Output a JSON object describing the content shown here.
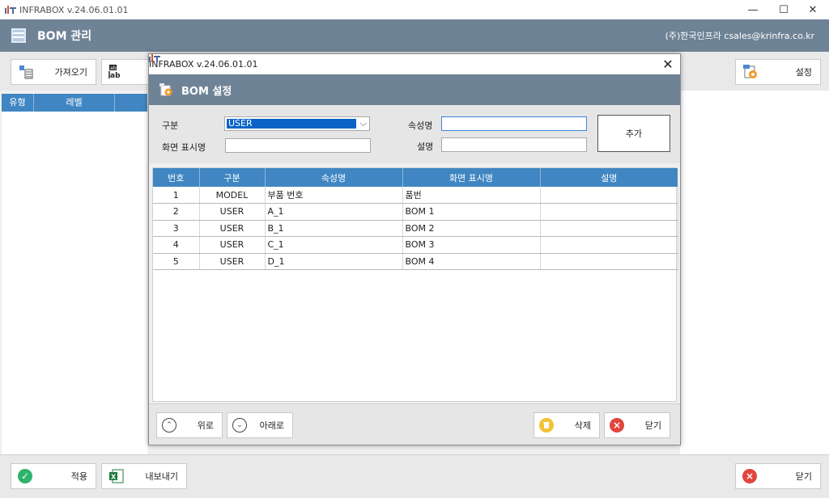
{
  "app": {
    "title": "INFRABOX  v.24.06.01.01",
    "header_title": "BOM 관리",
    "company": "(주)한국인프라  csales@krinfra.co.kr"
  },
  "window_controls": {
    "minimize": "—",
    "maximize": "☐",
    "close": "✕"
  },
  "toolbar": {
    "import_label": "가져오기",
    "settings_label": "설정"
  },
  "left_grid": {
    "columns": [
      "유형",
      "레벨"
    ]
  },
  "footer": {
    "apply_label": "적용",
    "export_label": "내보내기",
    "close_label": "닫기"
  },
  "dialog": {
    "title": "INFRABOX  v.24.06.01.01",
    "close": "✕",
    "header_title": "BOM 설정",
    "form": {
      "type_label": "구분",
      "type_value": "USER",
      "display_label": "화면 표시명",
      "display_value": "",
      "attr_label": "속성명",
      "attr_value": "",
      "desc_label": "설명",
      "desc_value": "",
      "add_label": "추가"
    },
    "table": {
      "columns": [
        "번호",
        "구분",
        "속성명",
        "화면 표시명",
        "설명"
      ],
      "rows": [
        [
          "1",
          "MODEL",
          "부품 번호",
          "품번",
          ""
        ],
        [
          "2",
          "USER",
          "A_1",
          "BOM 1",
          ""
        ],
        [
          "3",
          "USER",
          "B_1",
          "BOM 2",
          ""
        ],
        [
          "4",
          "USER",
          "C_1",
          "BOM 3",
          ""
        ],
        [
          "5",
          "USER",
          "D_1",
          "BOM 4",
          ""
        ]
      ]
    },
    "buttons": {
      "up_label": "위로",
      "down_label": "아래로",
      "delete_label": "삭제",
      "close_label": "닫기"
    }
  },
  "colors": {
    "header_bg": "#6f8396",
    "grid_header": "#3f86c2",
    "green": "#2db36a",
    "red": "#e0463c",
    "yellow": "#f2c232",
    "select_blue": "#0a64c8"
  }
}
